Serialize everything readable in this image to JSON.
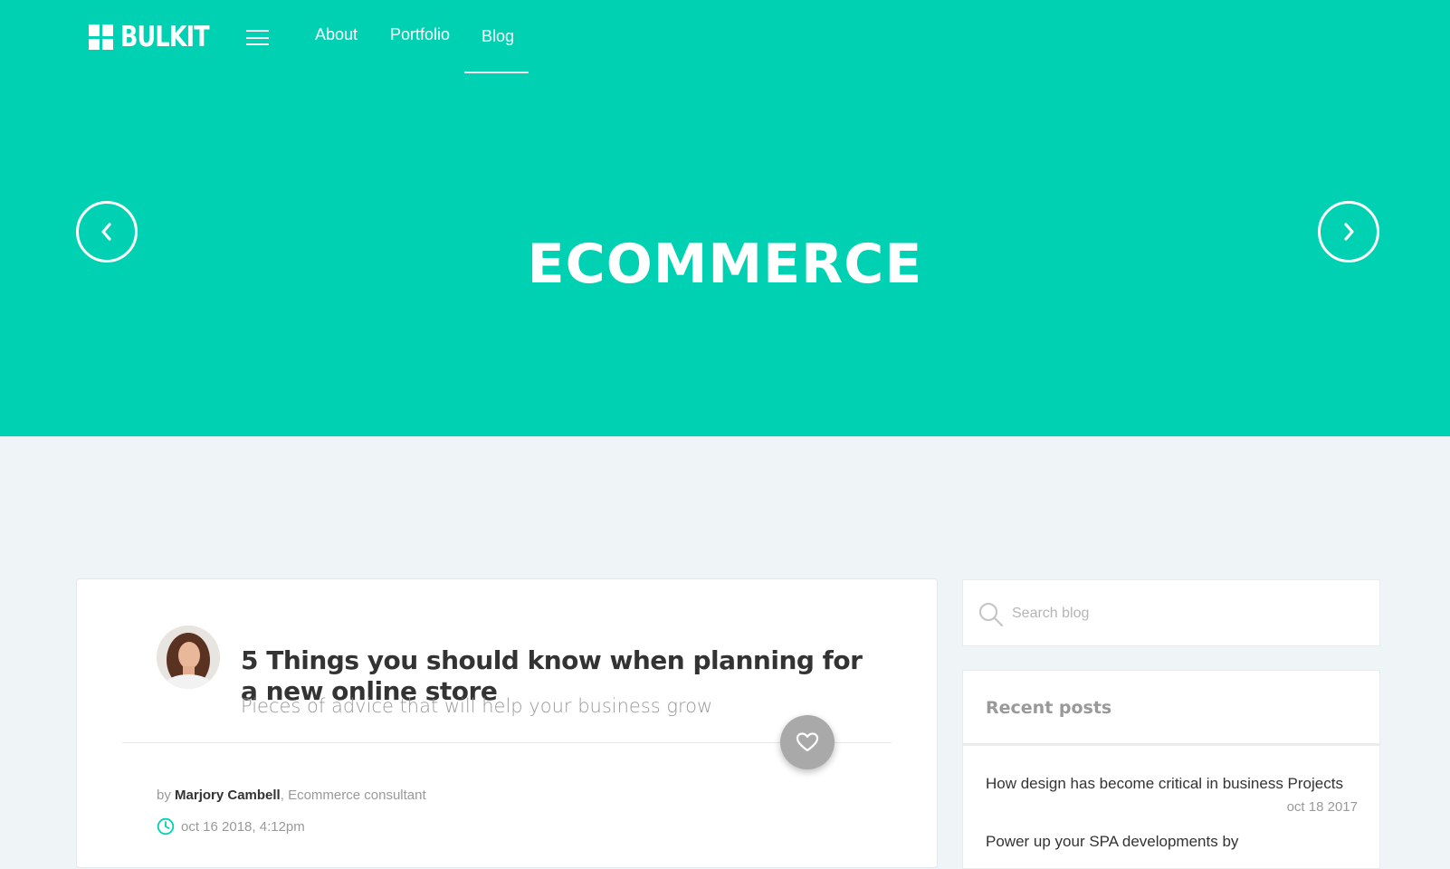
{
  "brand": {
    "name": "BULKIT",
    "accent_color": "#00d1b2"
  },
  "nav": {
    "menu_icon": "hamburger-icon",
    "links": [
      {
        "label": "About"
      },
      {
        "label": "Portfolio"
      },
      {
        "label": "Blog",
        "active": true
      }
    ]
  },
  "hero": {
    "title": "ECOMMERCE",
    "prev_icon": "chevron-left-icon",
    "next_icon": "chevron-right-icon"
  },
  "post": {
    "title": "5 Things you should know when planning for a new online store",
    "subtitle": "Pieces of advice that will help your business grow",
    "by_prefix": "by",
    "author": "Marjory Cambell",
    "author_role": ", Ecommerce consultant",
    "date": "oct 16 2018, 4:12pm",
    "like_icon": "heart-icon",
    "clock_icon": "clock-icon"
  },
  "sidebar": {
    "search": {
      "placeholder": "Search blog",
      "value": "",
      "icon": "search-icon"
    },
    "recent_posts": {
      "title": "Recent posts",
      "items": [
        {
          "title": "How design has become critical in business Projects",
          "date": "oct 18 2017"
        },
        {
          "title": "Power up your SPA developments by",
          "date": ""
        }
      ]
    }
  }
}
